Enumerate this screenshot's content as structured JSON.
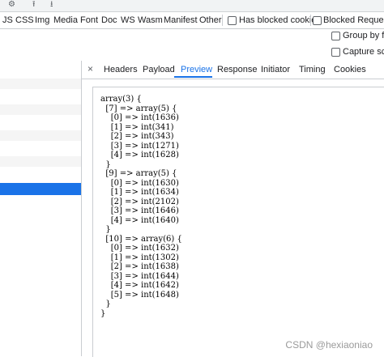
{
  "filter_bar": {
    "type_filters": [
      "JS",
      "CSS",
      "Img",
      "Media",
      "Font",
      "Doc",
      "WS",
      "Wasm",
      "Manifest",
      "Other"
    ],
    "has_blocked_cookies": "Has blocked cookies",
    "blocked_requests": "Blocked Requests"
  },
  "options": {
    "group_by_frame": "Group by fra",
    "capture_screenshots": "Capture scre"
  },
  "tabs": {
    "close": "×",
    "items": [
      "Headers",
      "Payload",
      "Preview",
      "Response",
      "Initiator",
      "Timing",
      "Cookies"
    ],
    "active": "Preview"
  },
  "preview": {
    "lines": [
      "array(3) {",
      "  [7] => array(5) {",
      "    [0] => int(1636)",
      "    [1] => int(341)",
      "    [2] => int(343)",
      "    [3] => int(1271)",
      "    [4] => int(1628)",
      "  }",
      "  [9] => array(5) {",
      "    [0] => int(1630)",
      "    [1] => int(1634)",
      "    [2] => int(2102)",
      "    [3] => int(1646)",
      "    [4] => int(1640)",
      "  }",
      "  [10] => array(6) {",
      "    [0] => int(1632)",
      "    [1] => int(1302)",
      "    [2] => int(1638)",
      "    [3] => int(1644)",
      "    [4] => int(1642)",
      "    [5] => int(1648)",
      "  }",
      "}"
    ]
  },
  "watermark": "CSDN @hexiaoniao",
  "colors": {
    "accent": "#1a73e8",
    "border": "#cacdd1"
  }
}
